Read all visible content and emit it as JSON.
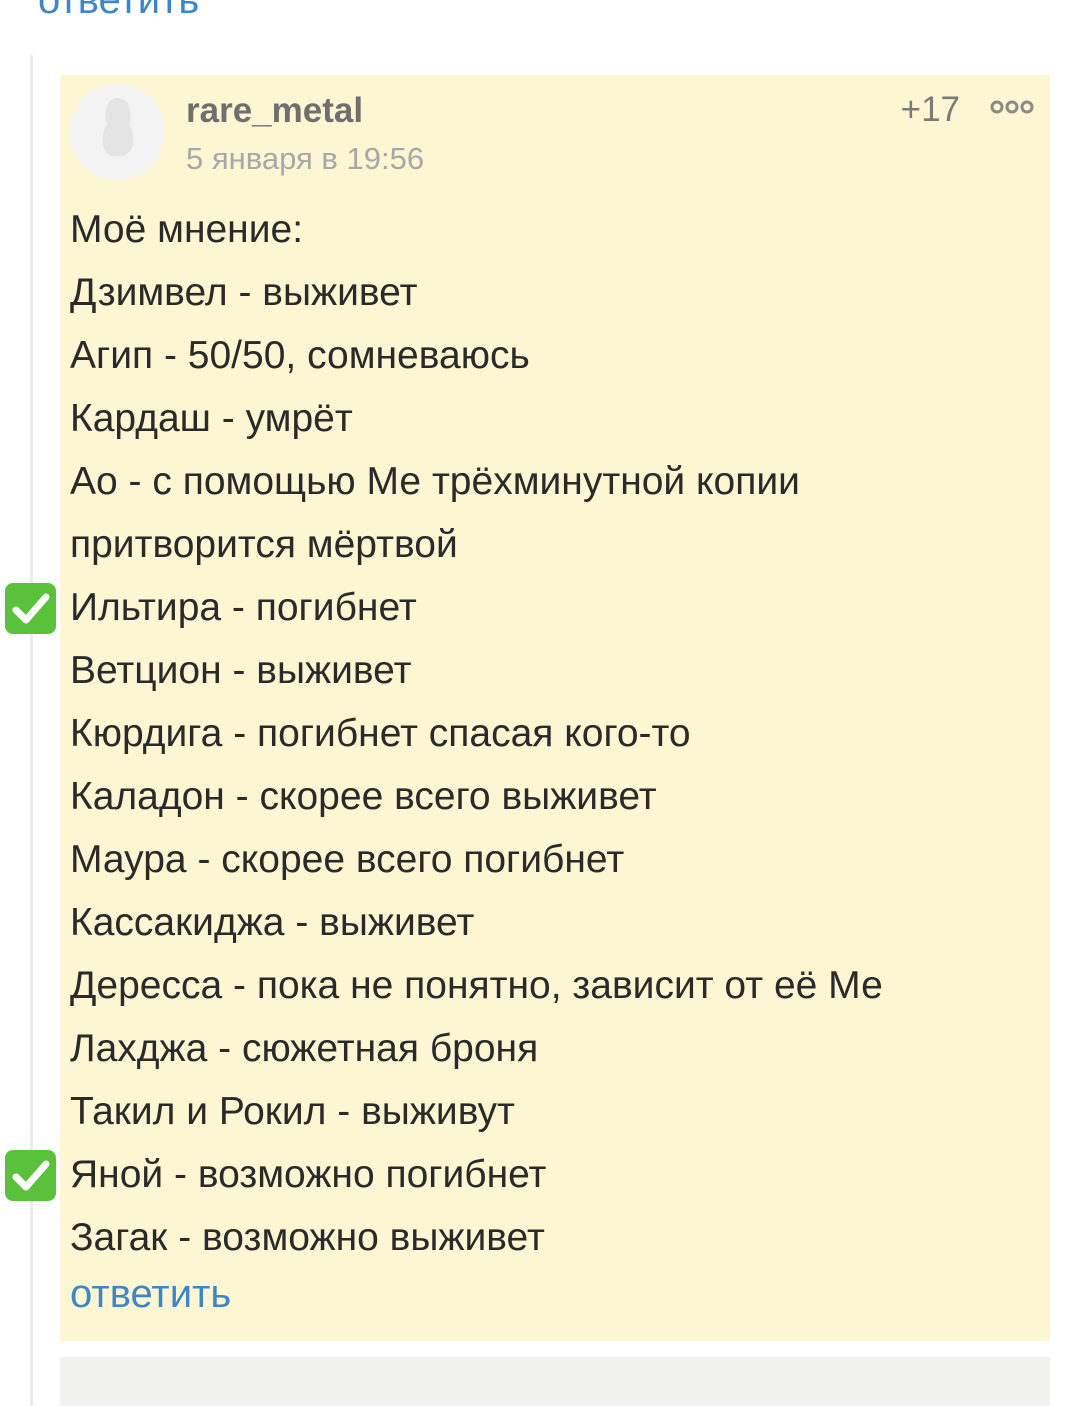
{
  "previous_comment": {
    "reply_label": "ответить"
  },
  "comment": {
    "author": "rare_metal",
    "date": "5 января в 19:56",
    "score": "+17",
    "lines": [
      "Моё мнение:",
      "Дзимвел - выживет",
      "Агип - 50/50, сомневаюсь",
      "Кардаш - умрёт",
      "Ао - с помощью Ме трёхминутной копии",
      "притворится мёртвой",
      "Ильтира - погибнет",
      "Ветцион - выживет",
      "Кюрдига - погибнет спасая кого-то",
      "Каладон - скорее всего выживет",
      "Маура - скорее всего погибнет",
      "Кассакиджа - выживет",
      "Дересса - пока не понятно, зависит от её Ме",
      "Лахджа - сюжетная броня",
      "Такил и Рокил - выживут",
      "Яной - возможно погибнет",
      "Загак - возможно выживет"
    ],
    "checked_lines": [
      6,
      15
    ],
    "reply_label": "ответить"
  },
  "icons": {
    "avatar": "default-avatar-silhouette",
    "more": "more-dots-icon",
    "check": "white-check-mark-icon"
  },
  "colors": {
    "comment_background": "#fdf6d3",
    "link": "#3f86c4",
    "check_green": "#5ac13b"
  }
}
